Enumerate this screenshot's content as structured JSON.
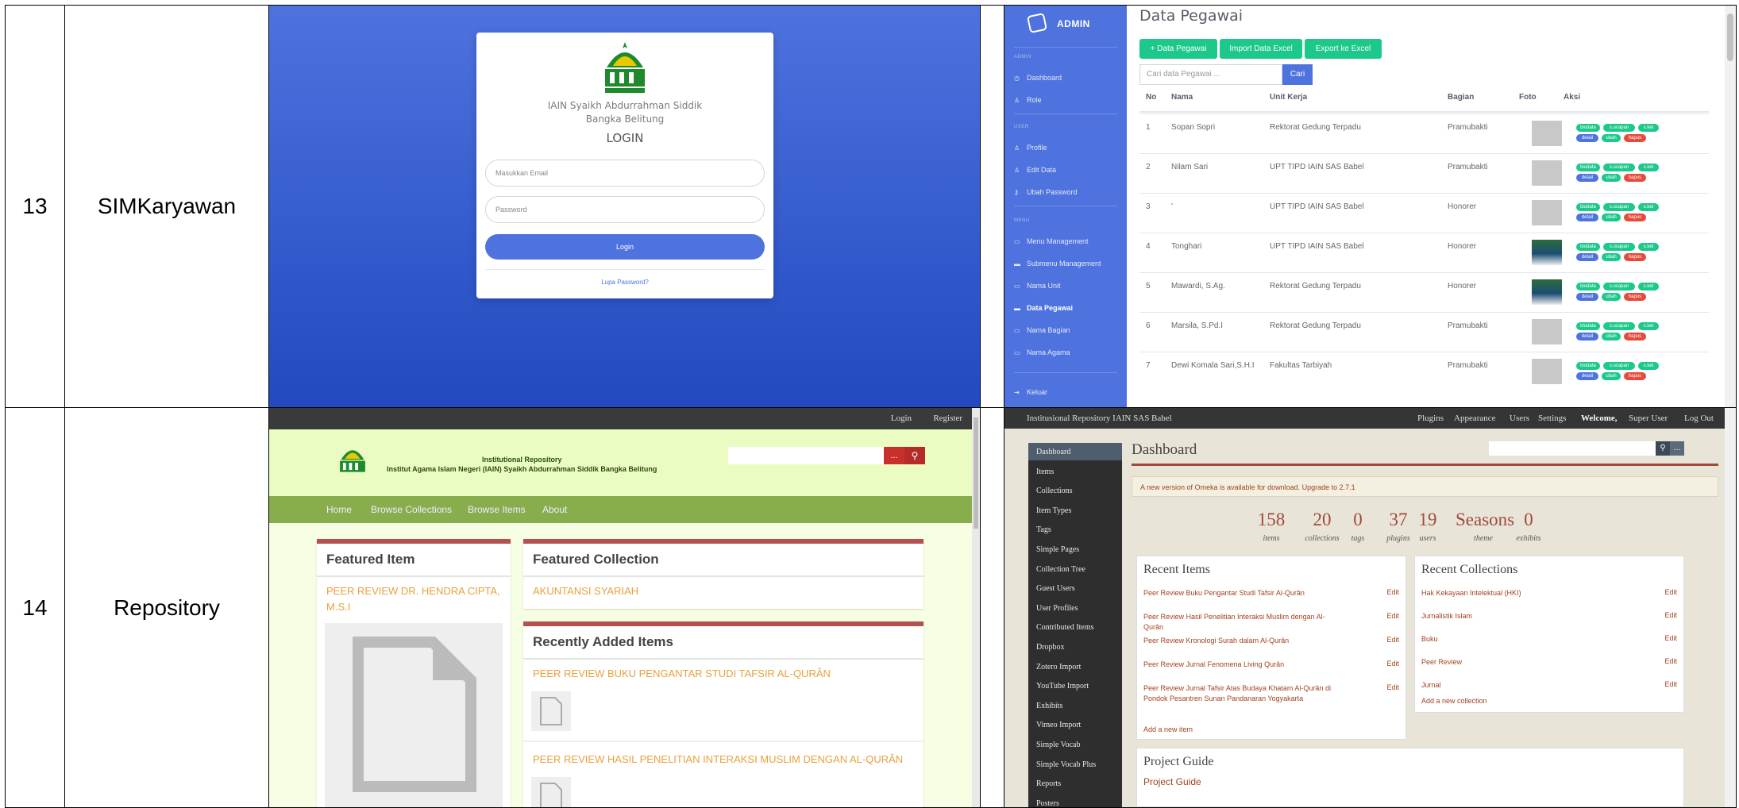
{
  "rows": [
    {
      "num": "13",
      "name": "SIMKaryawan"
    },
    {
      "num": "14",
      "name": "Repository"
    }
  ],
  "login": {
    "inst_line1": "IAIN Syaikh Abdurrahman Siddik",
    "inst_line2": "Bangka Belitung",
    "title": "LOGIN",
    "email_placeholder": "Masukkan Email",
    "password_placeholder": "Password",
    "login_button": "Login",
    "forgot": "Lupa Password?"
  },
  "admin": {
    "brand": "ADMIN",
    "sections": {
      "admin": "ADMIN",
      "user": "USER",
      "menu": "MENU"
    },
    "nav": {
      "dashboard": "Dashboard",
      "role": "Role",
      "profile": "Profile",
      "edit": "Edit Data",
      "password": "Ubah Password",
      "menu_mgmt": "Menu Management",
      "submenu": "Submenu Management",
      "unit": "Nama Unit",
      "pegawai": "Data Pegawai",
      "bagian": "Nama Bagian",
      "agama": "Nama Agama",
      "keluar": "Keluar"
    },
    "title": "Data Pegawai",
    "buttons": {
      "add": "+ Data Pegawai",
      "import": "Import Data Excel",
      "export": "Export ke Excel"
    },
    "search_placeholder": "Cari data Pegawai ...",
    "search_button": "Cari",
    "headers": {
      "no": "No",
      "nama": "Nama",
      "unit": "Unit Kerja",
      "bagian": "Bagian",
      "foto": "Foto",
      "aksi": "Aksi"
    },
    "badges": {
      "biodata": "biodata",
      "ucapan": "s.ucapan",
      "ket": "s.ket",
      "detail": "detail",
      "ubah": "ubah",
      "hapus": "hapus"
    },
    "rows": [
      {
        "no": "1",
        "nama": "Sopan Sopri",
        "unit": "Rektorat Gedung Terpadu",
        "bagian": "Pramubakti"
      },
      {
        "no": "2",
        "nama": "Nilam Sari",
        "unit": "UPT TIPD IAIN SAS Babel",
        "bagian": "Pramubakti"
      },
      {
        "no": "3",
        "nama": "'",
        "unit": "UPT TIPD IAIN SAS Babel",
        "bagian": "Honorer"
      },
      {
        "no": "4",
        "nama": "Tonghari",
        "unit": "UPT TIPD IAIN SAS Babel",
        "bagian": "Honorer"
      },
      {
        "no": "5",
        "nama": "Mawardi, S.Ag.",
        "unit": "Rektorat Gedung Terpadu",
        "bagian": "Honorer"
      },
      {
        "no": "6",
        "nama": "Marsila, S.Pd.I",
        "unit": "Rektorat Gedung Terpadu",
        "bagian": "Pramubakti"
      },
      {
        "no": "7",
        "nama": "Dewi Komala Sari,S.H.I",
        "unit": "Fakultas Tarbiyah",
        "bagian": "Pramubakti"
      }
    ]
  },
  "repo": {
    "top_links": {
      "login": "Login",
      "register": "Register"
    },
    "site_title_1": "Institutional Repository",
    "site_title_2": "Institut Agama Islam Negeri (IAIN) Syaikh Abdurrahman Siddik Bangka Belitung",
    "adv_search": "...",
    "nav": {
      "home": "Home",
      "collections": "Browse Collections",
      "items": "Browse Items",
      "about": "About"
    },
    "featured_item": "Featured Item",
    "featured_item_link": "PEER REVIEW DR. HENDRA CIPTA, M.S.I",
    "featured_collection": "Featured Collection",
    "featured_collection_link": "AKUNTANSI SYARIAH",
    "recent": "Recently Added Items",
    "recent_1": "PEER REVIEW BUKU PENGANTAR STUDI TAFSIR AL-QURÂN",
    "recent_2": "PEER REVIEW HASIL PENELITIAN INTERAKSI MUSLIM DENGAN AL-QURÂN"
  },
  "omeka": {
    "site": "Institusional Repository IAIN SAS Babel",
    "top_nav": {
      "plugins": "Plugins",
      "appearance": "Appearance",
      "users": "Users",
      "settings": "Settings",
      "welcome": "Welcome,",
      "user": "Super User",
      "logout": "Log Out"
    },
    "sidebar": [
      "Dashboard",
      "Items",
      "Collections",
      "Item Types",
      "Tags",
      "Simple Pages",
      "Collection Tree",
      "Guest Users",
      "User Profiles",
      "Contributed Items",
      "Dropbox",
      "Zotero Import",
      "YouTube Import",
      "Exhibits",
      "Vimeo Import",
      "Simple Vocab",
      "Simple Vocab Plus",
      "Reports",
      "Posters"
    ],
    "title": "Dashboard",
    "notice": "A new version of Omeka is available for download. Upgrade to 2.7.1",
    "stats": [
      {
        "value": "158",
        "label": "items"
      },
      {
        "value": "20",
        "label": "collections"
      },
      {
        "value": "0",
        "label": "tags"
      },
      {
        "value": "37",
        "label": "plugins"
      },
      {
        "value": "19",
        "label": "users"
      },
      {
        "value": "Seasons",
        "label": "theme"
      },
      {
        "value": "0",
        "label": "exhibits"
      }
    ],
    "recent_items_title": "Recent Items",
    "recent_items": [
      "Peer Review Buku Pengantar Studi Tafsir Al-Qurân",
      "Peer Review Hasil Penelitian Interaksi Muslim dengan Al-Qurân",
      "Peer Review Kronologi Surah dalam Al-Qurân",
      "Peer Review Jurnal Fenomena Living Qurân",
      "Peer Review Jurnal Tafsir Atas Budaya Khatam Al-Qurân di Pondok Pesantren Sunan Pandanaran Yogyakarta"
    ],
    "add_item": "Add a new item",
    "recent_collections_title": "Recent Collections",
    "recent_collections": [
      "Hak Kekayaan Intelektual (HKI)",
      "Jurnalistik Islam",
      "Buku",
      "Peer Review",
      "Jurnal"
    ],
    "add_collection": "Add a new collection",
    "edit": "Edit",
    "guide_title": "Project Guide",
    "guide_link": "Project Guide"
  }
}
